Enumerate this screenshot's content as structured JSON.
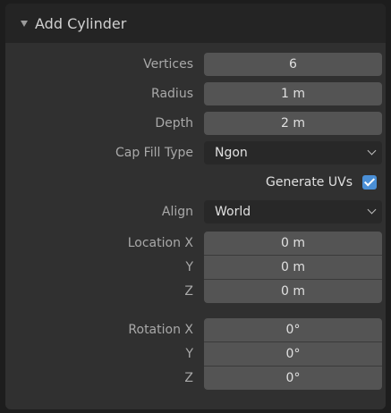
{
  "panel": {
    "title": "Add Cylinder"
  },
  "fields": {
    "vertices": {
      "label": "Vertices",
      "value": "6"
    },
    "radius": {
      "label": "Radius",
      "value": "1 m"
    },
    "depth": {
      "label": "Depth",
      "value": "2 m"
    },
    "cap_fill_type": {
      "label": "Cap Fill Type",
      "value": "Ngon"
    },
    "generate_uvs": {
      "label": "Generate UVs",
      "checked": true
    },
    "align": {
      "label": "Align",
      "value": "World"
    },
    "location": {
      "x_label": "Location X",
      "x_value": "0 m",
      "y_label": "Y",
      "y_value": "0 m",
      "z_label": "Z",
      "z_value": "0 m"
    },
    "rotation": {
      "x_label": "Rotation X",
      "x_value": "0°",
      "y_label": "Y",
      "y_value": "0°",
      "z_label": "Z",
      "z_value": "0°"
    }
  },
  "colors": {
    "accent": "#4a8fd6",
    "field_bg": "#545454",
    "dropdown_bg": "#282828",
    "panel_bg": "#303030",
    "header_bg": "#242424"
  }
}
